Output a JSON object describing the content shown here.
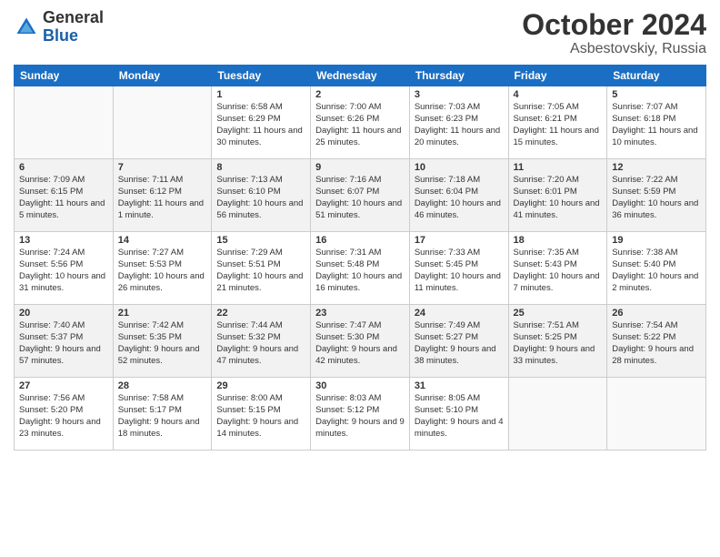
{
  "logo": {
    "general": "General",
    "blue": "Blue"
  },
  "title": "October 2024",
  "location": "Asbestovskiy, Russia",
  "days_of_week": [
    "Sunday",
    "Monday",
    "Tuesday",
    "Wednesday",
    "Thursday",
    "Friday",
    "Saturday"
  ],
  "weeks": [
    [
      {
        "day": "",
        "sunrise": "",
        "sunset": "",
        "daylight": ""
      },
      {
        "day": "",
        "sunrise": "",
        "sunset": "",
        "daylight": ""
      },
      {
        "day": "1",
        "sunrise": "Sunrise: 6:58 AM",
        "sunset": "Sunset: 6:29 PM",
        "daylight": "Daylight: 11 hours and 30 minutes."
      },
      {
        "day": "2",
        "sunrise": "Sunrise: 7:00 AM",
        "sunset": "Sunset: 6:26 PM",
        "daylight": "Daylight: 11 hours and 25 minutes."
      },
      {
        "day": "3",
        "sunrise": "Sunrise: 7:03 AM",
        "sunset": "Sunset: 6:23 PM",
        "daylight": "Daylight: 11 hours and 20 minutes."
      },
      {
        "day": "4",
        "sunrise": "Sunrise: 7:05 AM",
        "sunset": "Sunset: 6:21 PM",
        "daylight": "Daylight: 11 hours and 15 minutes."
      },
      {
        "day": "5",
        "sunrise": "Sunrise: 7:07 AM",
        "sunset": "Sunset: 6:18 PM",
        "daylight": "Daylight: 11 hours and 10 minutes."
      }
    ],
    [
      {
        "day": "6",
        "sunrise": "Sunrise: 7:09 AM",
        "sunset": "Sunset: 6:15 PM",
        "daylight": "Daylight: 11 hours and 5 minutes."
      },
      {
        "day": "7",
        "sunrise": "Sunrise: 7:11 AM",
        "sunset": "Sunset: 6:12 PM",
        "daylight": "Daylight: 11 hours and 1 minute."
      },
      {
        "day": "8",
        "sunrise": "Sunrise: 7:13 AM",
        "sunset": "Sunset: 6:10 PM",
        "daylight": "Daylight: 10 hours and 56 minutes."
      },
      {
        "day": "9",
        "sunrise": "Sunrise: 7:16 AM",
        "sunset": "Sunset: 6:07 PM",
        "daylight": "Daylight: 10 hours and 51 minutes."
      },
      {
        "day": "10",
        "sunrise": "Sunrise: 7:18 AM",
        "sunset": "Sunset: 6:04 PM",
        "daylight": "Daylight: 10 hours and 46 minutes."
      },
      {
        "day": "11",
        "sunrise": "Sunrise: 7:20 AM",
        "sunset": "Sunset: 6:01 PM",
        "daylight": "Daylight: 10 hours and 41 minutes."
      },
      {
        "day": "12",
        "sunrise": "Sunrise: 7:22 AM",
        "sunset": "Sunset: 5:59 PM",
        "daylight": "Daylight: 10 hours and 36 minutes."
      }
    ],
    [
      {
        "day": "13",
        "sunrise": "Sunrise: 7:24 AM",
        "sunset": "Sunset: 5:56 PM",
        "daylight": "Daylight: 10 hours and 31 minutes."
      },
      {
        "day": "14",
        "sunrise": "Sunrise: 7:27 AM",
        "sunset": "Sunset: 5:53 PM",
        "daylight": "Daylight: 10 hours and 26 minutes."
      },
      {
        "day": "15",
        "sunrise": "Sunrise: 7:29 AM",
        "sunset": "Sunset: 5:51 PM",
        "daylight": "Daylight: 10 hours and 21 minutes."
      },
      {
        "day": "16",
        "sunrise": "Sunrise: 7:31 AM",
        "sunset": "Sunset: 5:48 PM",
        "daylight": "Daylight: 10 hours and 16 minutes."
      },
      {
        "day": "17",
        "sunrise": "Sunrise: 7:33 AM",
        "sunset": "Sunset: 5:45 PM",
        "daylight": "Daylight: 10 hours and 11 minutes."
      },
      {
        "day": "18",
        "sunrise": "Sunrise: 7:35 AM",
        "sunset": "Sunset: 5:43 PM",
        "daylight": "Daylight: 10 hours and 7 minutes."
      },
      {
        "day": "19",
        "sunrise": "Sunrise: 7:38 AM",
        "sunset": "Sunset: 5:40 PM",
        "daylight": "Daylight: 10 hours and 2 minutes."
      }
    ],
    [
      {
        "day": "20",
        "sunrise": "Sunrise: 7:40 AM",
        "sunset": "Sunset: 5:37 PM",
        "daylight": "Daylight: 9 hours and 57 minutes."
      },
      {
        "day": "21",
        "sunrise": "Sunrise: 7:42 AM",
        "sunset": "Sunset: 5:35 PM",
        "daylight": "Daylight: 9 hours and 52 minutes."
      },
      {
        "day": "22",
        "sunrise": "Sunrise: 7:44 AM",
        "sunset": "Sunset: 5:32 PM",
        "daylight": "Daylight: 9 hours and 47 minutes."
      },
      {
        "day": "23",
        "sunrise": "Sunrise: 7:47 AM",
        "sunset": "Sunset: 5:30 PM",
        "daylight": "Daylight: 9 hours and 42 minutes."
      },
      {
        "day": "24",
        "sunrise": "Sunrise: 7:49 AM",
        "sunset": "Sunset: 5:27 PM",
        "daylight": "Daylight: 9 hours and 38 minutes."
      },
      {
        "day": "25",
        "sunrise": "Sunrise: 7:51 AM",
        "sunset": "Sunset: 5:25 PM",
        "daylight": "Daylight: 9 hours and 33 minutes."
      },
      {
        "day": "26",
        "sunrise": "Sunrise: 7:54 AM",
        "sunset": "Sunset: 5:22 PM",
        "daylight": "Daylight: 9 hours and 28 minutes."
      }
    ],
    [
      {
        "day": "27",
        "sunrise": "Sunrise: 7:56 AM",
        "sunset": "Sunset: 5:20 PM",
        "daylight": "Daylight: 9 hours and 23 minutes."
      },
      {
        "day": "28",
        "sunrise": "Sunrise: 7:58 AM",
        "sunset": "Sunset: 5:17 PM",
        "daylight": "Daylight: 9 hours and 18 minutes."
      },
      {
        "day": "29",
        "sunrise": "Sunrise: 8:00 AM",
        "sunset": "Sunset: 5:15 PM",
        "daylight": "Daylight: 9 hours and 14 minutes."
      },
      {
        "day": "30",
        "sunrise": "Sunrise: 8:03 AM",
        "sunset": "Sunset: 5:12 PM",
        "daylight": "Daylight: 9 hours and 9 minutes."
      },
      {
        "day": "31",
        "sunrise": "Sunrise: 8:05 AM",
        "sunset": "Sunset: 5:10 PM",
        "daylight": "Daylight: 9 hours and 4 minutes."
      },
      {
        "day": "",
        "sunrise": "",
        "sunset": "",
        "daylight": ""
      },
      {
        "day": "",
        "sunrise": "",
        "sunset": "",
        "daylight": ""
      }
    ]
  ]
}
